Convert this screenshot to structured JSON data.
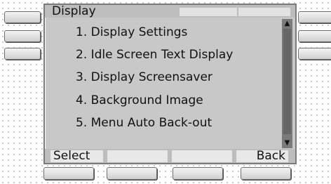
{
  "screen": {
    "title": "Display",
    "menu_items": [
      "1. Display Settings",
      "2. Idle Screen Text Display",
      "3. Display Screensaver",
      "4. Background Image",
      "5. Menu Auto Back-out"
    ],
    "softkeys": [
      "Select",
      "",
      "",
      "Back"
    ],
    "scroll_up_icon": "arrow-up-icon",
    "scroll_down_icon": "arrow-down-icon"
  }
}
